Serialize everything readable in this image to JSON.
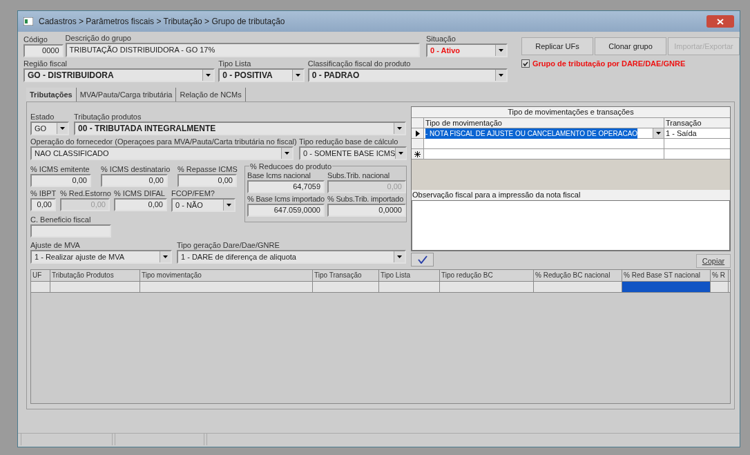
{
  "window": {
    "title": "Cadastros > Parâmetros fiscais > Tributação > Grupo de tributação"
  },
  "header": {
    "codigo": {
      "label": "Código",
      "value": "0000"
    },
    "descricao": {
      "label": "Descrição do grupo",
      "value": "TRIBUTAÇÃO DISTRIBUIDORA - GO 17%"
    },
    "situacao": {
      "label": "Situação",
      "value": "0 - Ativo"
    },
    "regiao_fiscal": {
      "label": "Região fiscal",
      "value": "GO - DISTRIBUIDORA"
    },
    "tipo_lista": {
      "label": "Tipo Lista",
      "value": "0 - POSITIVA"
    },
    "classificacao": {
      "label": "Classificação fiscal do produto",
      "value": "0 - PADRAO"
    }
  },
  "buttons": [
    {
      "label": "Replicar UFs",
      "disabled": false
    },
    {
      "label": "Clonar grupo",
      "disabled": false
    },
    {
      "label": "Importar/Exportar",
      "disabled": true
    }
  ],
  "dare_checkbox": {
    "label": "Grupo de tributação por DARE/DAE/GNRE",
    "checked": true
  },
  "tabs": [
    {
      "label": "Tributações",
      "selected": true
    },
    {
      "label": "MVA/Pauta/Carga tributária",
      "selected": false
    },
    {
      "label": "Relação de NCMs",
      "selected": false
    }
  ],
  "form": {
    "estado": {
      "label": "Estado",
      "value": "GO"
    },
    "tributacao_produtos": {
      "label": "Tributação produtos",
      "value": "00 - TRIBUTADA INTEGRALMENTE"
    },
    "operacao_fornecedor": {
      "label": "Operação do fornecedor (Operaçoes para MVA/Pauta/Carta tributária no fiscal)",
      "value": "NAO CLASSIFICADO"
    },
    "tipo_reducao": {
      "label": "Tipo redução base de cálculo",
      "value": "0 - SOMENTE BASE ICMS"
    },
    "icms_emitente": {
      "label": "% ICMS emitente",
      "value": "0,00",
      "disabled": false
    },
    "icms_destinatario": {
      "label": "% ICMS destinatario",
      "value": "0,00",
      "disabled": false
    },
    "repasse_icms": {
      "label": "% Repasse ICMS",
      "value": "0,00",
      "disabled": false
    },
    "ibpt": {
      "label": "% IBPT",
      "value": "0,00",
      "disabled": false
    },
    "red_estorno": {
      "label": "% Red.Estorno",
      "value": "0,00",
      "disabled": true
    },
    "icms_difal": {
      "label": "% ICMS DIFAL",
      "value": "0,00",
      "disabled": false
    },
    "fcop": {
      "label": "FCOP/FEM?",
      "value": "0 - NÃO"
    },
    "beneficio": {
      "label": "C. Beneficio fiscal"
    },
    "reducoes": {
      "title": "% Reducoes do produto",
      "fields": [
        {
          "label": "Base Icms nacional",
          "value": "64,7059",
          "disabled": false
        },
        {
          "label": "Subs.Trib. nacional",
          "value": "0,00",
          "disabled": true
        },
        {
          "label": "% Base Icms importado",
          "value": "647.059,0000",
          "disabled": false
        },
        {
          "label": "% Subs.Trib. importado",
          "value": "0,0000",
          "disabled": false
        }
      ]
    },
    "ajuste_mva": {
      "label": "Ajuste de MVA",
      "value": "1 - Realizar ajuste de MVA"
    },
    "tipo_geracao": {
      "label": "Tipo geração Dare/Dae/GNRE",
      "value": "1 - DARE de diferença de aliquota"
    }
  },
  "movimentacoes": {
    "title": "Tipo de movimentações e transações",
    "columns": [
      "Tipo de movimentação",
      "Transação"
    ],
    "rows": [
      {
        "cells": [
          "- NOTA FISCAL DE AJUSTE OU CANCELAMENTO DE OPERACAO",
          "1 - Saída"
        ],
        "selected": true
      },
      {
        "cells": [],
        "selected": false
      }
    ],
    "observacao_label": "Observação fiscal para a impressão da nota fiscal",
    "copy_button": "Copiar"
  },
  "grid": {
    "columns": [
      "UF",
      "Tributação Produtos",
      "Tipo movimentação",
      "Tipo Transação",
      "Tipo Lista",
      "Tipo redução BC",
      "% Redução BC nacional",
      "% Red Base ST nacional",
      "% R"
    ],
    "rows": [
      {
        "cells": [
          {
            "selected": false
          },
          {
            "selected": false
          },
          {
            "selected": false
          },
          {
            "selected": false
          },
          {
            "selected": false
          },
          {
            "selected": false
          },
          {
            "selected": false
          },
          {
            "selected": true
          },
          {
            "selected": false
          }
        ]
      }
    ]
  }
}
